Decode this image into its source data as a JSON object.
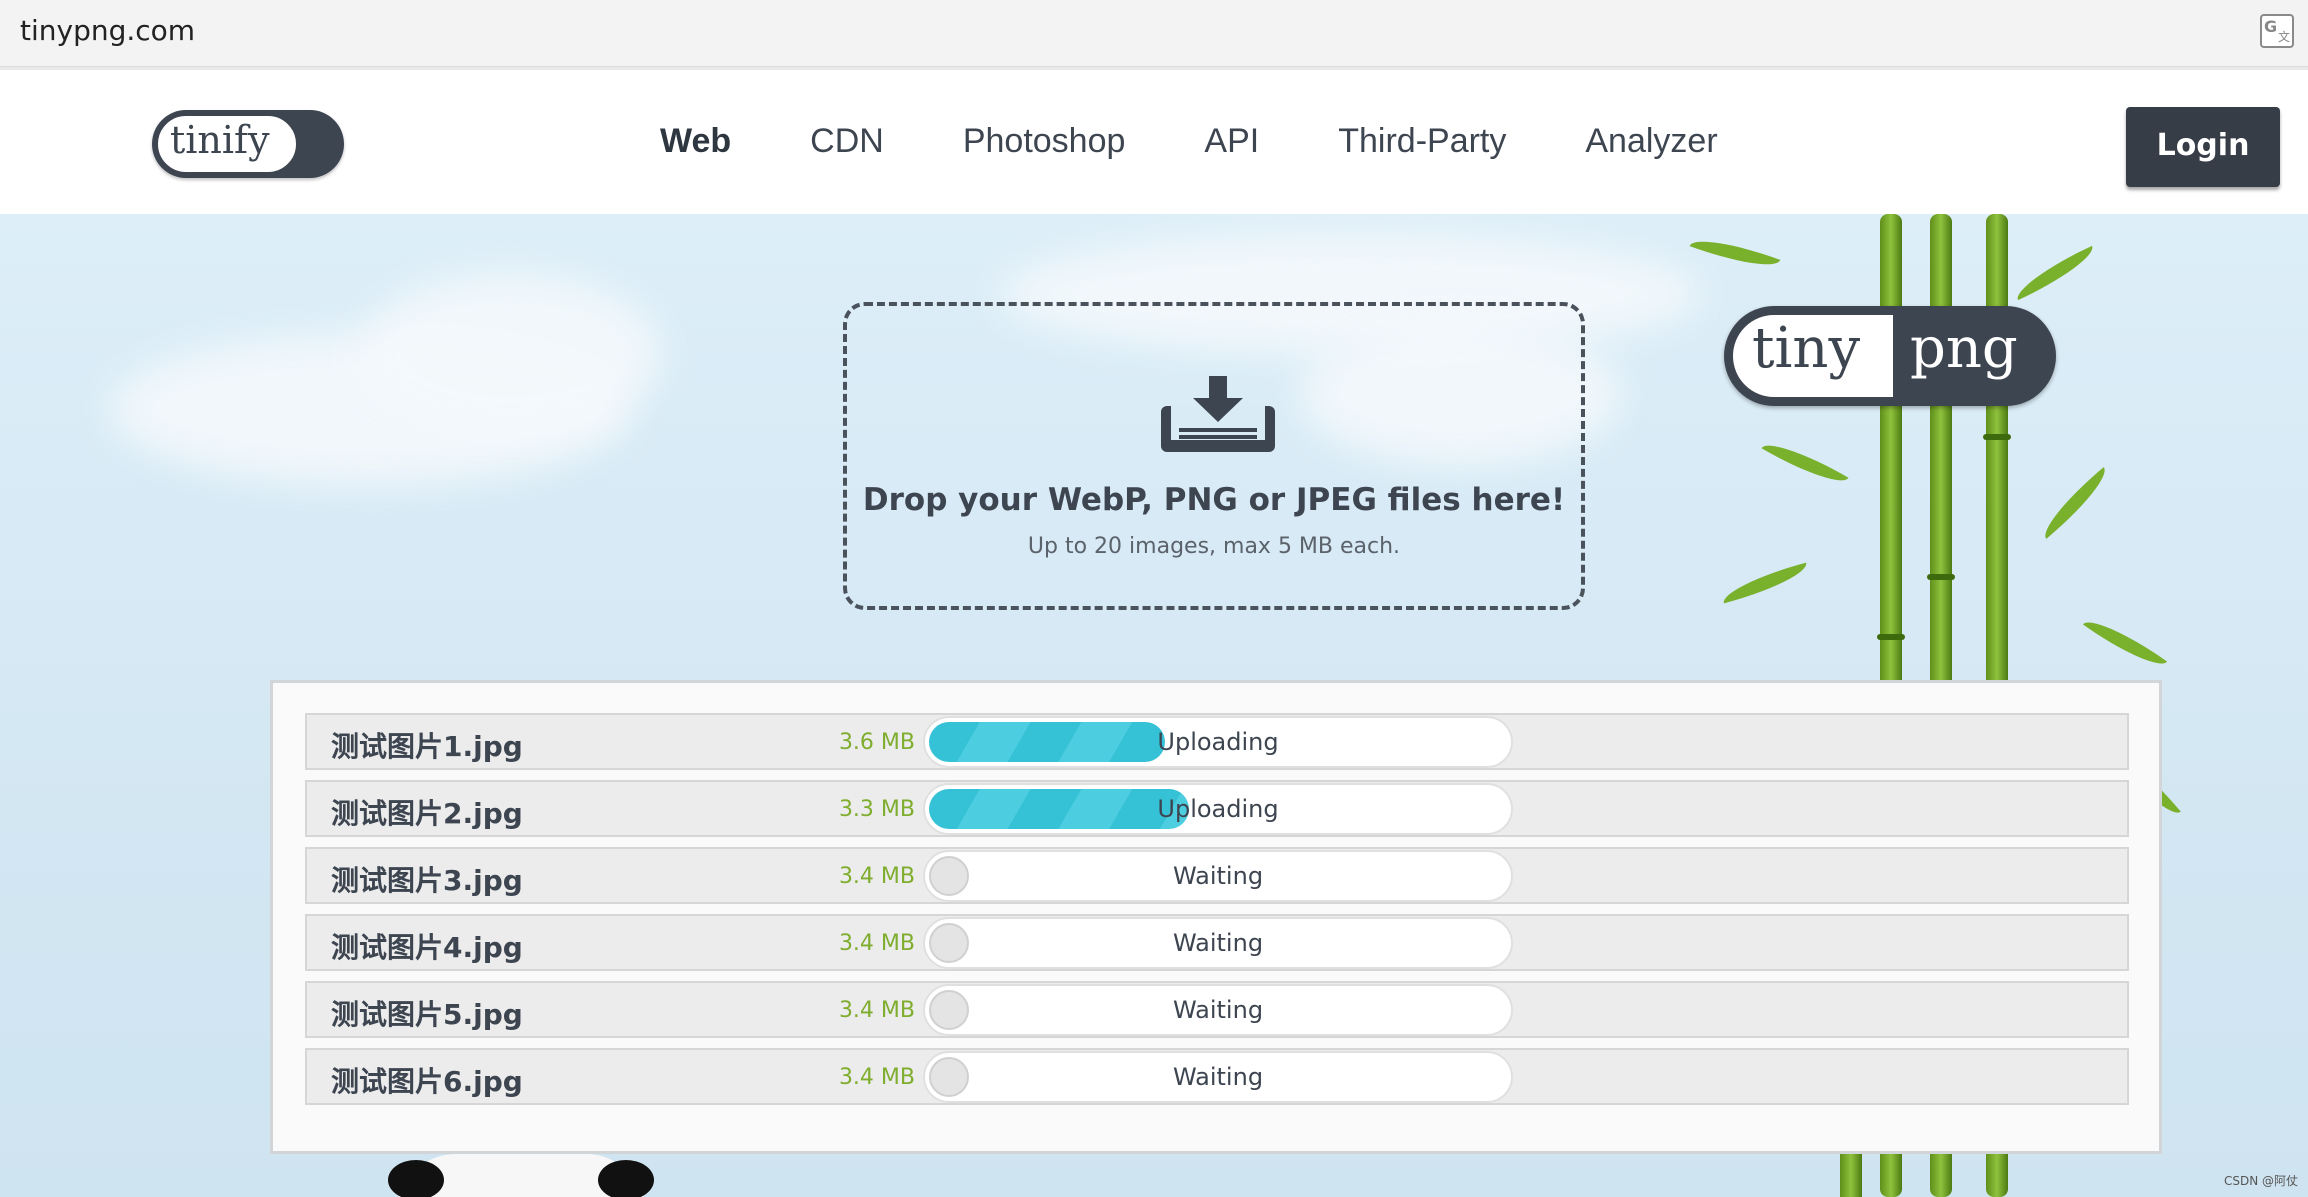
{
  "browser": {
    "url": "tinypng.com"
  },
  "header": {
    "logo": "tinify",
    "menu": [
      "Web",
      "CDN",
      "Photoshop",
      "API",
      "Third-Party",
      "Analyzer"
    ],
    "active_menu": "Web",
    "login": "Login"
  },
  "hero": {
    "brand_left": "tiny",
    "brand_right": "png",
    "drop_title": "Drop your WebP, PNG or JPEG files here!",
    "drop_subtitle": "Up to 20 images, max 5 MB each."
  },
  "files": [
    {
      "name": "测试图片1.jpg",
      "size": "3.6 MB",
      "status": "Uploading",
      "progress": 0.41
    },
    {
      "name": "测试图片2.jpg",
      "size": "3.3 MB",
      "status": "Uploading",
      "progress": 0.45
    },
    {
      "name": "测试图片3.jpg",
      "size": "3.4 MB",
      "status": "Waiting",
      "progress": 0
    },
    {
      "name": "测试图片4.jpg",
      "size": "3.4 MB",
      "status": "Waiting",
      "progress": 0
    },
    {
      "name": "测试图片5.jpg",
      "size": "3.4 MB",
      "status": "Waiting",
      "progress": 0
    },
    {
      "name": "测试图片6.jpg",
      "size": "3.4 MB",
      "status": "Waiting",
      "progress": 0
    }
  ],
  "colors": {
    "accent": "#35c1d6",
    "size_text": "#7fad2e",
    "dark": "#3d4550"
  },
  "watermark": "CSDN @阿仗"
}
